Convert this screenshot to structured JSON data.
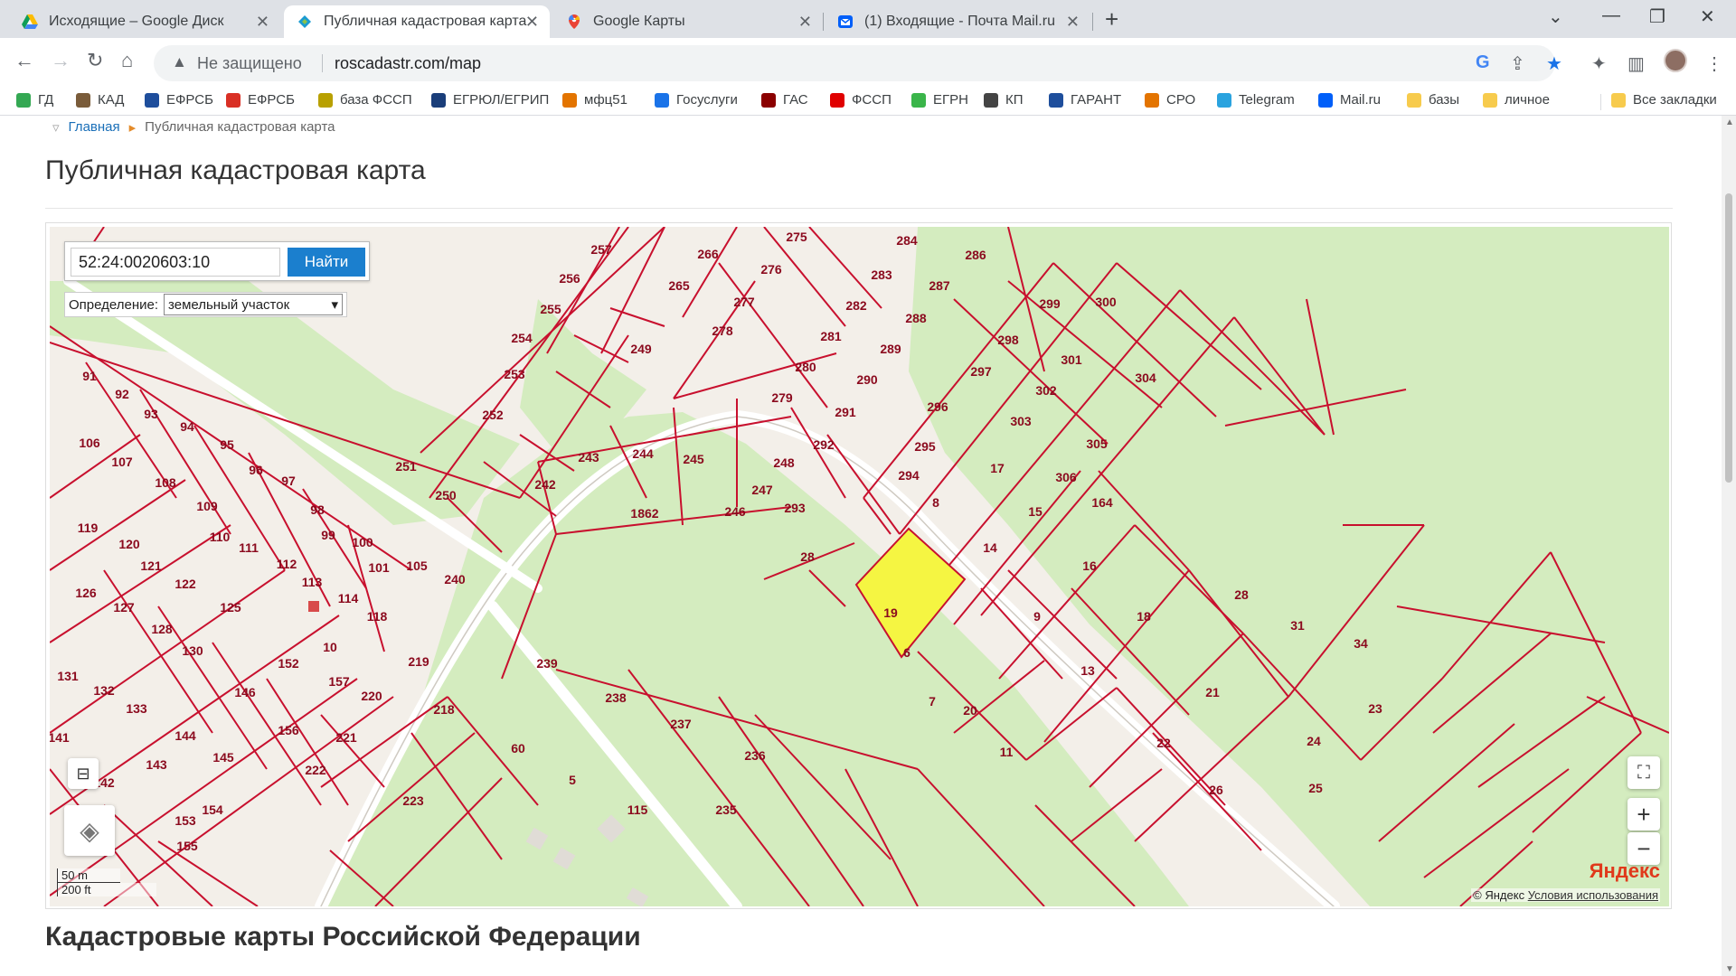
{
  "tabs": [
    {
      "title": "Исходящие – Google Диск",
      "icon": "google-drive-icon"
    },
    {
      "title": "Публичная кадастровая карта",
      "icon": "cadastre-icon"
    },
    {
      "title": "Google Карты",
      "icon": "google-maps-icon"
    },
    {
      "title": "(1) Входящие - Почта Mail.ru",
      "icon": "mail-icon"
    }
  ],
  "address": {
    "security": "Не защищено",
    "url": "roscadastr.com/map"
  },
  "bookmarks": [
    "ГД",
    "КАД",
    "ЕФРСБ",
    "ЕФРСБ",
    "база ФССП",
    "ЕГРЮЛ/ЕГРИП",
    "мфц51",
    "Госуслуги",
    "ГАС",
    "ФССП",
    "ЕГРН",
    "КП",
    "ГАРАНТ",
    "СРО",
    "Telegram",
    "Mail.ru",
    "базы",
    "личное",
    "Все закладки"
  ],
  "colors": {
    "parcel_stroke": "#c8102e",
    "selected_fill": "#f5f542",
    "green": "#d4ecbf",
    "search_button": "#1b7fce",
    "yandex": "#e0391b"
  },
  "breadcrumb": {
    "home": "Главная",
    "current": "Публичная кадастровая карта"
  },
  "page": {
    "title": "Публичная кадастровая карта",
    "section_title": "Кадастровые карты Российской Федерации"
  },
  "search": {
    "value": "52:24:0020603:10",
    "button": "Найти",
    "definition_label": "Определение:",
    "definition_value": "земельный участок"
  },
  "map": {
    "selected_parcel": "10",
    "scale_m": "50 m",
    "scale_ft": "200 ft",
    "copyright": "© Яндекс",
    "terms": "Условия использования",
    "provider": "Яндекс",
    "zoom_in": "+",
    "zoom_out": "−",
    "parcel_labels": [
      "257",
      "256",
      "255",
      "254",
      "253",
      "252",
      "251",
      "250",
      "249",
      "266",
      "265",
      "276",
      "277",
      "278",
      "275",
      "284",
      "283",
      "282",
      "281",
      "280",
      "279",
      "286",
      "287",
      "288",
      "289",
      "290",
      "291",
      "292",
      "293",
      "294",
      "295",
      "296",
      "297",
      "298",
      "299",
      "300",
      "301",
      "302",
      "303",
      "304",
      "305",
      "306",
      "17",
      "15",
      "8",
      "14",
      "16",
      "9",
      "18",
      "13",
      "164",
      "28",
      "31",
      "34",
      "21",
      "22",
      "24",
      "23",
      "26",
      "25",
      "19",
      "6",
      "20",
      "7",
      "11",
      "242",
      "243",
      "244",
      "245",
      "248",
      "247",
      "246",
      "1862",
      "240",
      "239",
      "238",
      "237",
      "236",
      "235",
      "219",
      "220",
      "218",
      "221",
      "222",
      "223",
      "60",
      "5",
      "91",
      "92",
      "93",
      "94",
      "95",
      "96",
      "97",
      "98",
      "99",
      "100",
      "101",
      "105",
      "106",
      "107",
      "108",
      "109",
      "110",
      "111",
      "112",
      "113",
      "114",
      "118",
      "119",
      "120",
      "121",
      "122",
      "125",
      "126",
      "127",
      "128",
      "130",
      "131",
      "132",
      "133",
      "141",
      "142",
      "143",
      "144",
      "145",
      "146",
      "152",
      "153",
      "154",
      "155",
      "156",
      "157",
      "10",
      "28",
      "115"
    ]
  }
}
